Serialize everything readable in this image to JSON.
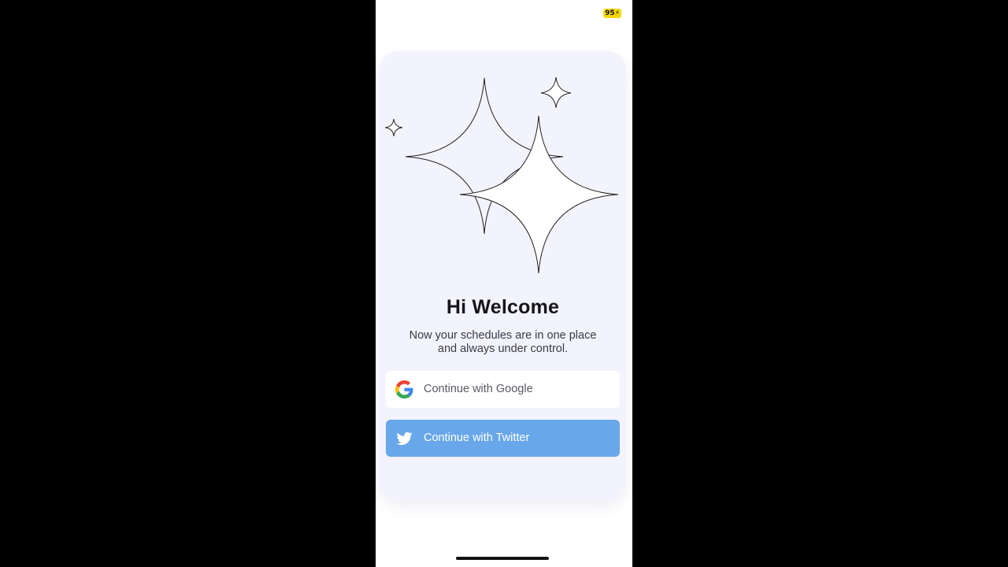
{
  "status_bar": {
    "battery_text": "95"
  },
  "welcome": {
    "title": "Hi Welcome",
    "subtitle_line1": "Now your schedules are in one place",
    "subtitle_line2": "and always under control."
  },
  "buttons": {
    "google_label": "Continue with Google",
    "twitter_label": "Continue with Twitter"
  },
  "colors": {
    "card_bg": "#f3f3fd",
    "twitter_blue": "#68a7ea",
    "battery_yellow": "#f5d90a"
  },
  "icons": {
    "illustration": "sparkle-stars",
    "google": "google-icon",
    "twitter": "twitter-icon"
  }
}
